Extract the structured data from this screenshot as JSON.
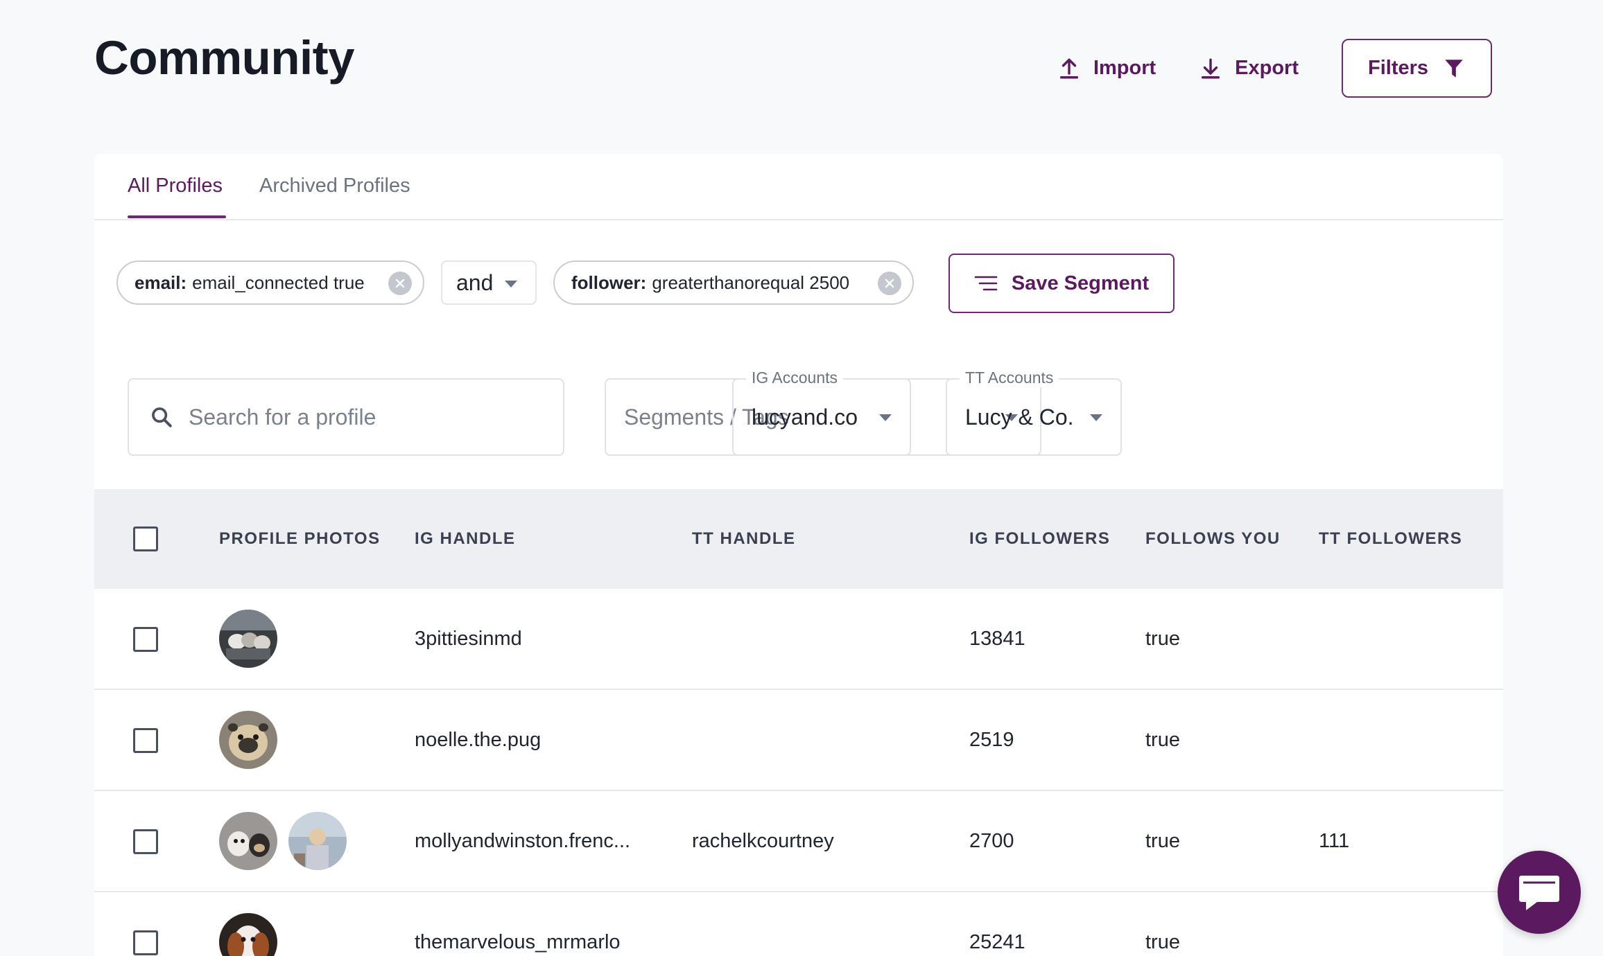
{
  "page": {
    "title": "Community"
  },
  "actions": {
    "import": "Import",
    "export": "Export",
    "filters": "Filters"
  },
  "tabs": [
    "All Profiles",
    "Archived Profiles"
  ],
  "filters": {
    "chip1": {
      "key": "email:",
      "value": "email_connected true"
    },
    "operator": "and",
    "chip2": {
      "key": "follower:",
      "value": "greaterthanorequal 2500"
    },
    "save_segment": "Save Segment"
  },
  "search": {
    "placeholder": "Search for a profile"
  },
  "segments": {
    "placeholder": "Segments / Tags"
  },
  "ig_accounts": {
    "label": "IG Accounts",
    "value": "lucyand.co"
  },
  "tt_accounts": {
    "label": "TT Accounts",
    "value": "Lucy & Co."
  },
  "table": {
    "headers": [
      "PROFILE PHOTOS",
      "IG HANDLE",
      "TT HANDLE",
      "IG FOLLOWERS",
      "FOLLOWS YOU",
      "TT FOLLOWERS"
    ],
    "rows": [
      {
        "ig_handle": "3pittiesinmd",
        "tt_handle": "",
        "ig_followers": "13841",
        "follows_you": "true",
        "tt_followers": ""
      },
      {
        "ig_handle": "noelle.the.pug",
        "tt_handle": "",
        "ig_followers": "2519",
        "follows_you": "true",
        "tt_followers": ""
      },
      {
        "ig_handle": "mollyandwinston.frenc...",
        "tt_handle": "rachelkcourtney",
        "ig_followers": "2700",
        "follows_you": "true",
        "tt_followers": "111"
      },
      {
        "ig_handle": "themarvelous_mrmarlo",
        "tt_handle": "",
        "ig_followers": "25241",
        "follows_you": "true",
        "tt_followers": ""
      }
    ]
  },
  "colors": {
    "accent": "#5b1a5f",
    "header_bg": "#eeeff2",
    "page_bg": "#f8f9fb"
  }
}
